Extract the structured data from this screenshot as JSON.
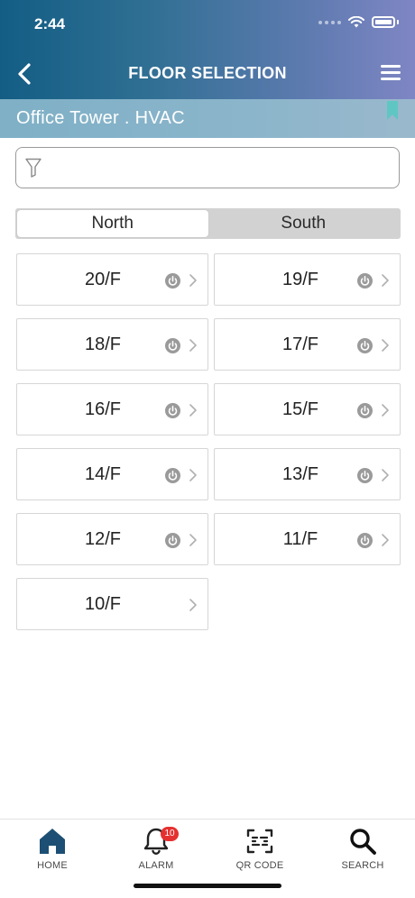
{
  "status_bar": {
    "time": "2:44"
  },
  "nav": {
    "title": "FLOOR SELECTION"
  },
  "location": {
    "text": "Office Tower . HVAC"
  },
  "filter": {
    "placeholder": ""
  },
  "segments": [
    {
      "label": "North",
      "active": true
    },
    {
      "label": "South",
      "active": false
    }
  ],
  "floors": [
    {
      "label": "20/F",
      "power": true
    },
    {
      "label": "19/F",
      "power": true
    },
    {
      "label": "18/F",
      "power": true
    },
    {
      "label": "17/F",
      "power": true
    },
    {
      "label": "16/F",
      "power": true
    },
    {
      "label": "15/F",
      "power": true
    },
    {
      "label": "14/F",
      "power": true
    },
    {
      "label": "13/F",
      "power": true
    },
    {
      "label": "12/F",
      "power": true
    },
    {
      "label": "11/F",
      "power": true
    },
    {
      "label": "10/F",
      "power": false
    }
  ],
  "tabs": [
    {
      "label": "HOME",
      "icon": "home-icon"
    },
    {
      "label": "ALARM",
      "icon": "bell-icon",
      "badge": "10"
    },
    {
      "label": "QR CODE",
      "icon": "qr-scan-icon"
    },
    {
      "label": "SEARCH",
      "icon": "search-icon"
    }
  ],
  "colors": {
    "accent": "#1c4f73",
    "badge": "#e53030",
    "header_start": "#135d84",
    "header_end": "#7f86c4"
  }
}
